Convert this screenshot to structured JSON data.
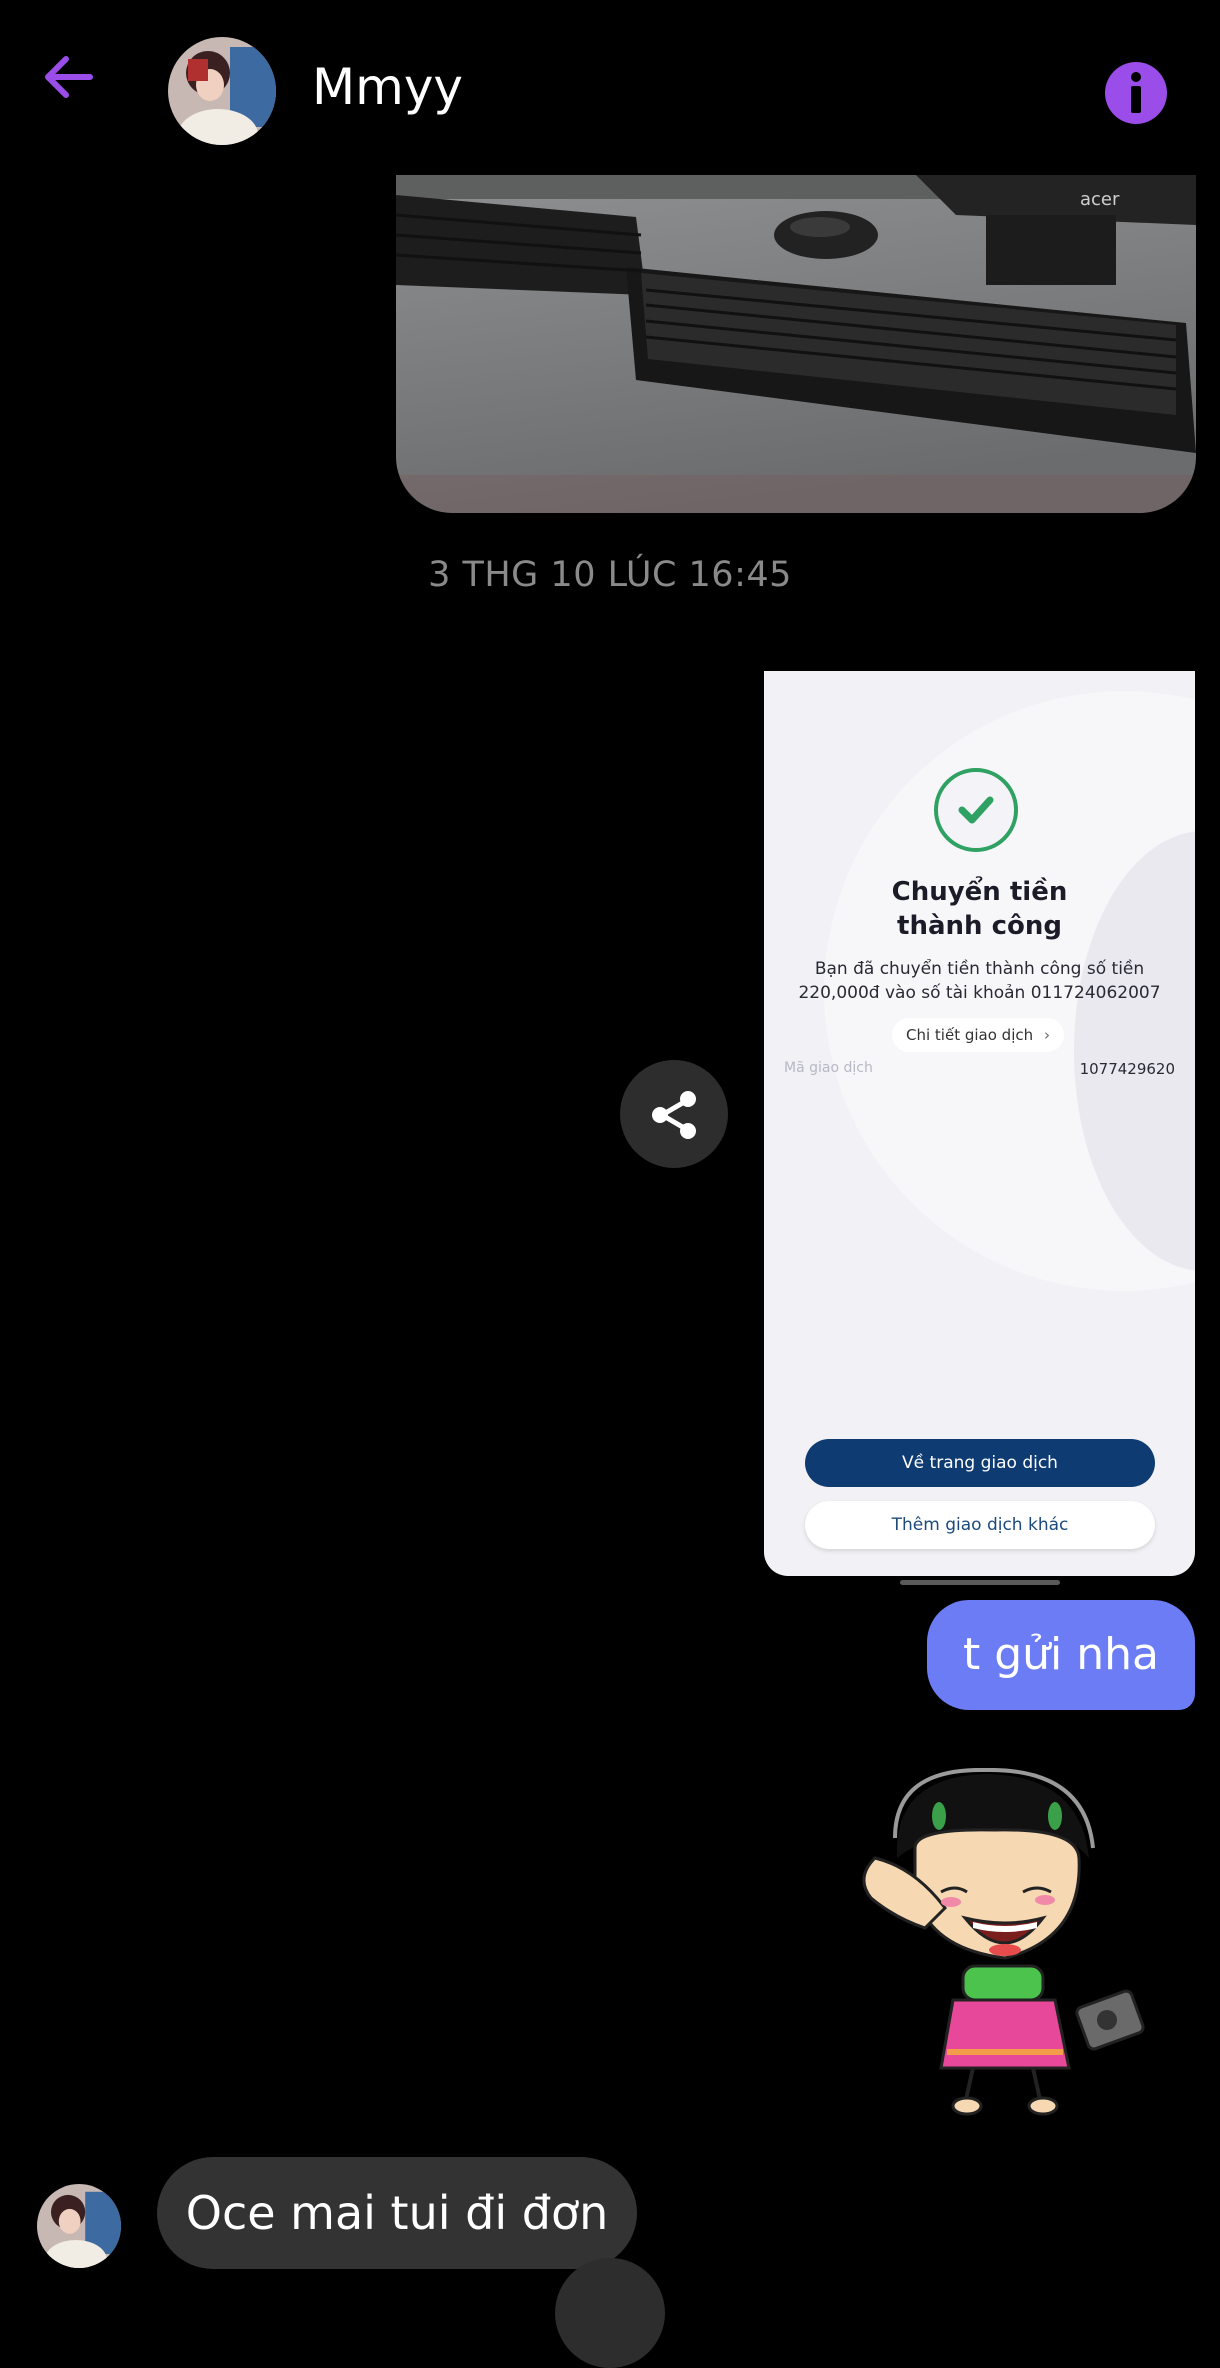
{
  "header": {
    "contact_name": "Mmyy",
    "back_icon": "arrow-left-icon",
    "info_icon": "info-icon",
    "accent_color": "#9b4dea"
  },
  "thread": {
    "timestamp": "3 THG 10 LÚC 16:45",
    "photo_brand": "acer",
    "transfer_screenshot": {
      "title_line1": "Chuyển tiền",
      "title_line2": "thành công",
      "desc_line1": "Bạn đã chuyển tiền thành công số tiền",
      "desc_line2": "220,000đ vào số tài khoản 011724062007",
      "detail_link": "Chi tiết giao dịch",
      "txn_label": "Mã giao dịch",
      "txn_id": "1077429620",
      "primary_button": "Về trang giao dịch",
      "secondary_button": "Thêm giao dịch khác"
    },
    "outgoing_message": "t gửi nha",
    "incoming_message": "Oce mai tui đi đơn"
  }
}
